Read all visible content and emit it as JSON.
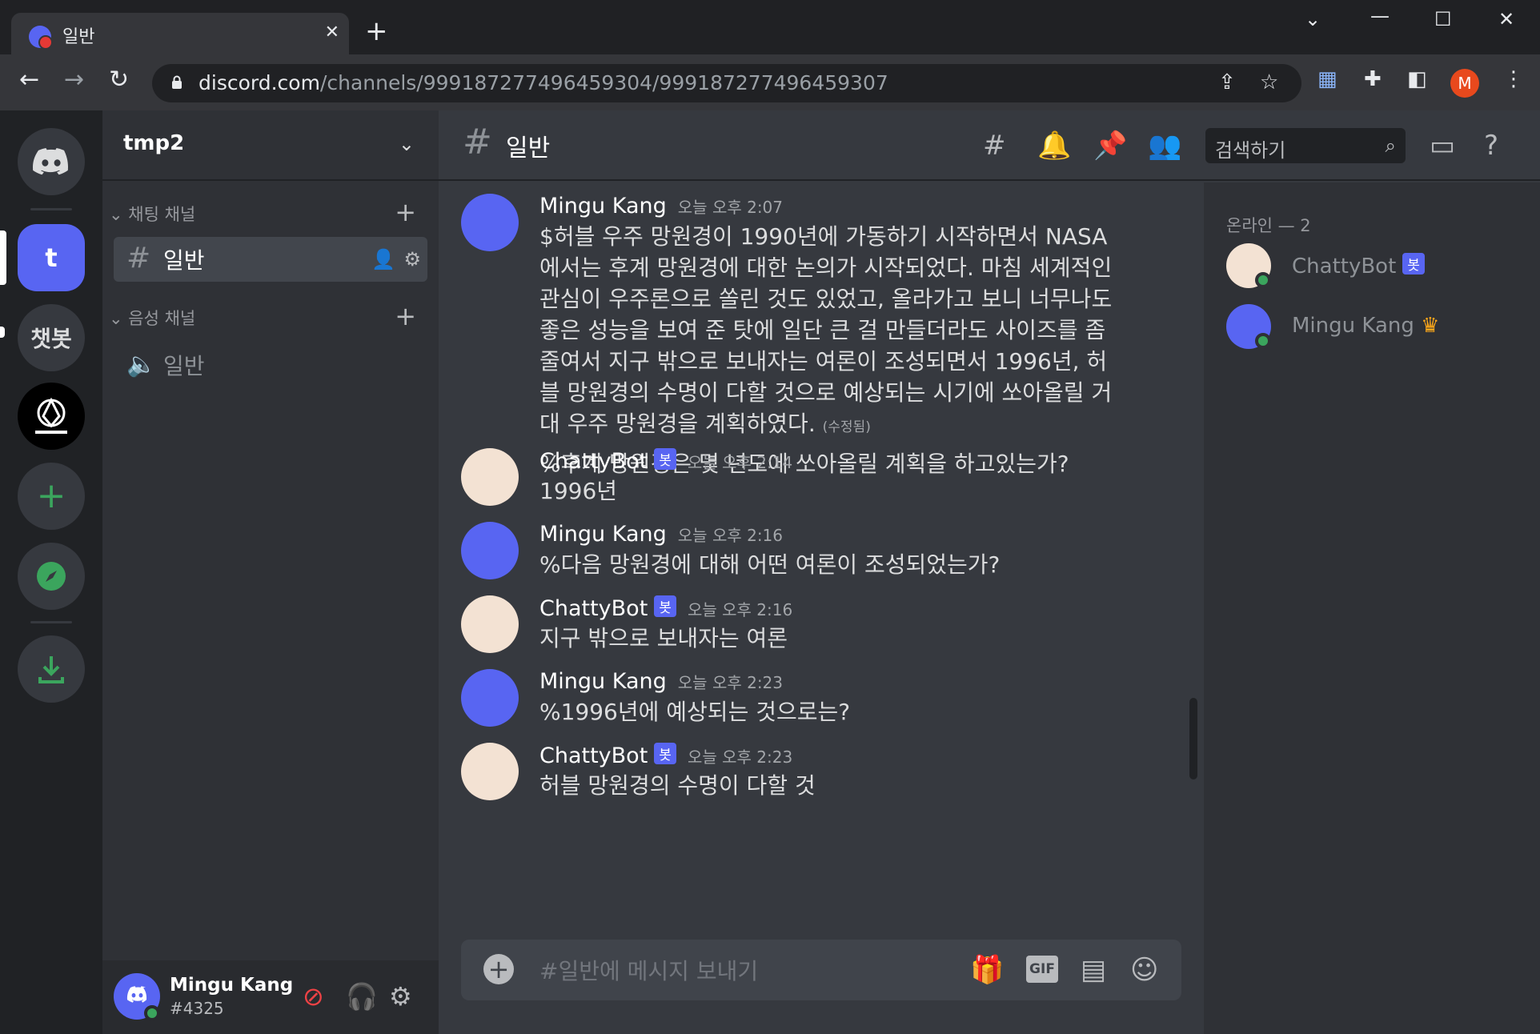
{
  "browser": {
    "tab_title": "일반",
    "url_domain": "discord.com",
    "url_path": "/channels/999187277496459304/999187277496459307",
    "profile_initial": "M"
  },
  "guilds": {
    "items": [
      {
        "label": "t"
      },
      {
        "label": "챗봇"
      }
    ]
  },
  "server": {
    "name": "tmp2",
    "categories": [
      {
        "label": "채팅 채널"
      },
      {
        "label": "음성 채널"
      }
    ],
    "text_channel": "일반",
    "voice_channel": "일반"
  },
  "user_panel": {
    "name": "Mingu Kang",
    "tag": "#4325"
  },
  "chat": {
    "channel_name": "일반",
    "search_placeholder": "검색하기",
    "composer_placeholder": "#일반에 메시지 보내기",
    "gif_label": "GIF",
    "messages": [
      {
        "author": "Mingu Kang",
        "time": "오늘 오후 2:07",
        "text": "$허블 우주 망원경이 1990년에 가동하기 시작하면서 NASA에서는 후계 망원경에 대한 논의가 시작되었다. 마침 세계적인 관심이 우주론으로 쏠린 것도 있었고, 올라가고 보니 너무나도 좋은 성능을 보여 준 탓에 일단 큰 걸 만들더라도 사이즈를 좀 줄여서 지구 밖으로 보내자는 여론이 조성되면서 1996년, 허블 망원경의 수명이 다할 것으로 예상되는 시기에 쏘아올릴 거대 우주 망원경을 계획하였다.",
        "edited": "(수정됨)",
        "text2": "%후계 망원경은 몇 년도에 쏘아올릴 계획을 하고있는가?"
      },
      {
        "author": "ChattyBot",
        "bot_tag": "봇",
        "time": "오늘 오후 2:14",
        "text": "1996년"
      },
      {
        "author": "Mingu Kang",
        "time": "오늘 오후 2:16",
        "text": "%다음 망원경에 대해 어떤 여론이 조성되었는가?"
      },
      {
        "author": "ChattyBot",
        "bot_tag": "봇",
        "time": "오늘 오후 2:16",
        "text": "지구 밖으로 보내자는 여론"
      },
      {
        "author": "Mingu Kang",
        "time": "오늘 오후 2:23",
        "text": "%1996년에 예상되는 것으로는?"
      },
      {
        "author": "ChattyBot",
        "bot_tag": "봇",
        "time": "오늘 오후 2:23",
        "text": "허블 망원경의 수명이 다할 것"
      }
    ]
  },
  "members": {
    "header": "온라인 — 2",
    "list": [
      {
        "name": "ChattyBot",
        "bot_tag": "봇"
      },
      {
        "name": "Mingu Kang"
      }
    ]
  },
  "colors": {
    "blurple": "#5865f2",
    "online": "#3ba55d",
    "background": "#36393f"
  }
}
